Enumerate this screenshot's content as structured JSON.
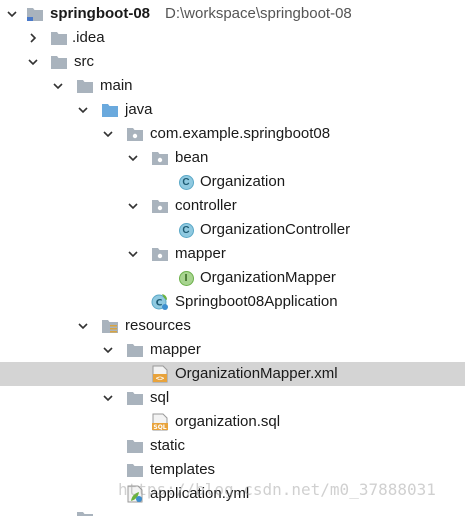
{
  "tree": {
    "root": {
      "name": "springboot-08",
      "path": "D:\\workspace\\springboot-08"
    },
    "idea": "idea",
    "idea_dot": ".",
    "src": "src",
    "main": "main",
    "java": "java",
    "package": "com.example.springboot08",
    "bean": "bean",
    "organization": "Organization",
    "controller": "controller",
    "organization_controller": "OrganizationController",
    "mapper_pkg": "mapper",
    "organization_mapper": "OrganizationMapper",
    "application_class": "Springboot08Application",
    "resources": "resources",
    "mapper_dir": "mapper",
    "organization_mapper_xml": "OrganizationMapper.xml",
    "sql_dir": "sql",
    "organization_sql": "organization.sql",
    "static": "static",
    "templates": "templates",
    "application_yml": "application.yml"
  },
  "selected_item": "OrganizationMapper.xml",
  "watermark": "https://blog.csdn.net/m0_37888031",
  "icons": {
    "folder": "folder-icon",
    "source_root": "source-root-folder-icon",
    "resources_root": "resources-root-folder-icon",
    "package": "package-icon",
    "class": "class-icon",
    "interface": "interface-icon",
    "spring_boot_app": "spring-boot-app-icon",
    "xml": "xml-file-icon",
    "sql": "sql-file-icon",
    "yml": "yml-file-icon"
  },
  "colors": {
    "selection": "#d4d4d4",
    "folder": "#a9b3bd",
    "source_root": "#6aa9dd",
    "class_badge": "#8fc9e0",
    "interface_badge": "#a7d48f"
  }
}
